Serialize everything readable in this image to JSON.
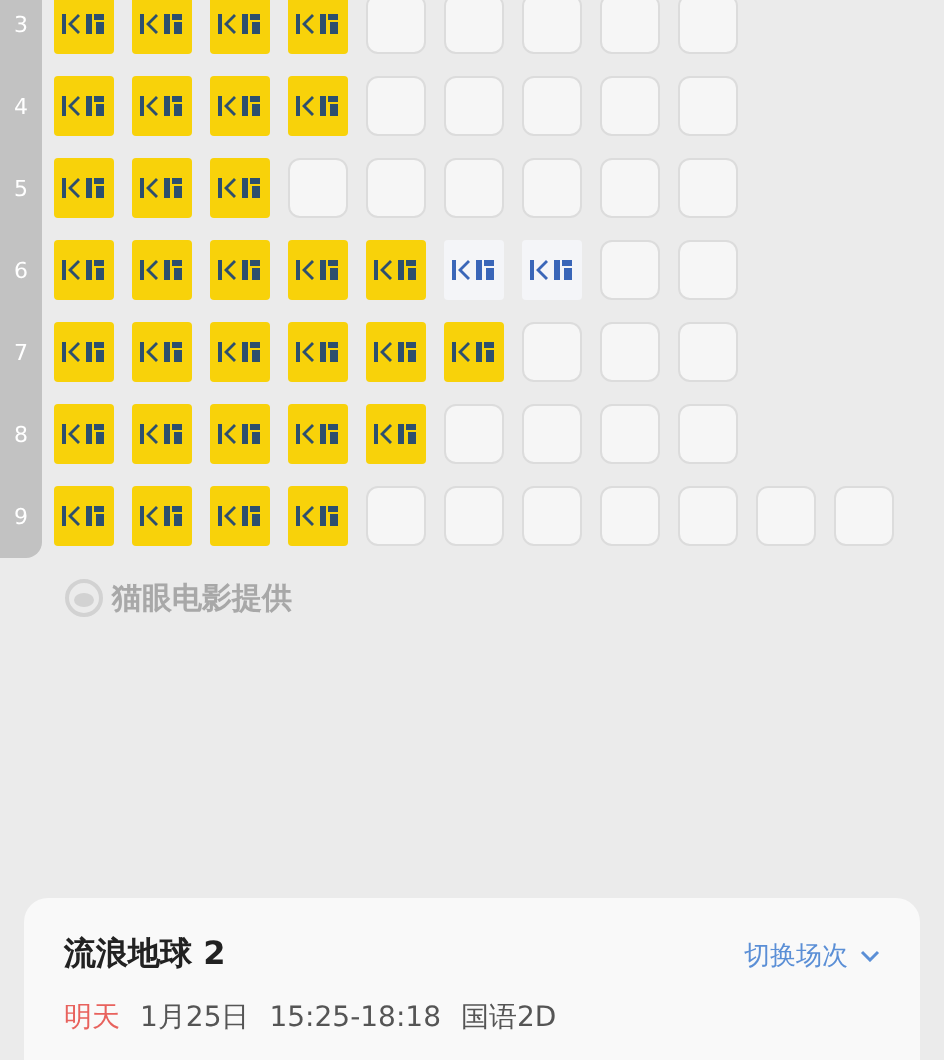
{
  "rows": [
    {
      "label": "3",
      "seats": [
        {
          "kind": "sold"
        },
        {
          "kind": "sold"
        },
        {
          "kind": "sold"
        },
        {
          "kind": "sold"
        },
        {
          "kind": "empty"
        },
        {
          "kind": "empty"
        },
        {
          "kind": "empty"
        },
        {
          "kind": "empty"
        },
        {
          "kind": "empty"
        }
      ]
    },
    {
      "label": "4",
      "seats": [
        {
          "kind": "sold"
        },
        {
          "kind": "sold"
        },
        {
          "kind": "sold"
        },
        {
          "kind": "sold"
        },
        {
          "kind": "empty"
        },
        {
          "kind": "empty"
        },
        {
          "kind": "empty"
        },
        {
          "kind": "empty"
        },
        {
          "kind": "empty"
        }
      ]
    },
    {
      "label": "5",
      "seats": [
        {
          "kind": "sold"
        },
        {
          "kind": "sold"
        },
        {
          "kind": "sold"
        },
        {
          "kind": "empty"
        },
        {
          "kind": "empty"
        },
        {
          "kind": "empty"
        },
        {
          "kind": "empty"
        },
        {
          "kind": "empty"
        },
        {
          "kind": "empty"
        }
      ]
    },
    {
      "label": "6",
      "seats": [
        {
          "kind": "sold"
        },
        {
          "kind": "sold"
        },
        {
          "kind": "sold"
        },
        {
          "kind": "sold"
        },
        {
          "kind": "sold"
        },
        {
          "kind": "locked"
        },
        {
          "kind": "locked"
        },
        {
          "kind": "empty"
        },
        {
          "kind": "empty"
        }
      ]
    },
    {
      "label": "7",
      "seats": [
        {
          "kind": "sold"
        },
        {
          "kind": "sold"
        },
        {
          "kind": "sold"
        },
        {
          "kind": "sold"
        },
        {
          "kind": "sold"
        },
        {
          "kind": "sold"
        },
        {
          "kind": "empty"
        },
        {
          "kind": "empty"
        },
        {
          "kind": "empty"
        }
      ]
    },
    {
      "label": "8",
      "seats": [
        {
          "kind": "sold"
        },
        {
          "kind": "sold"
        },
        {
          "kind": "sold"
        },
        {
          "kind": "sold"
        },
        {
          "kind": "sold"
        },
        {
          "kind": "empty"
        },
        {
          "kind": "empty"
        },
        {
          "kind": "empty"
        },
        {
          "kind": "empty"
        }
      ]
    },
    {
      "label": "9",
      "seats": [
        {
          "kind": "sold"
        },
        {
          "kind": "sold"
        },
        {
          "kind": "sold"
        },
        {
          "kind": "sold"
        },
        {
          "kind": "empty"
        },
        {
          "kind": "empty"
        },
        {
          "kind": "empty"
        },
        {
          "kind": "empty"
        },
        {
          "kind": "empty"
        },
        {
          "kind": "empty"
        },
        {
          "kind": "empty"
        }
      ]
    }
  ],
  "provider": "猫眼电影提供",
  "show": {
    "title": "流浪地球 2",
    "switch_label": "切换场次",
    "day": "明天",
    "date": "1月25日",
    "time": "15:25-18:18",
    "version": "国语2D"
  }
}
